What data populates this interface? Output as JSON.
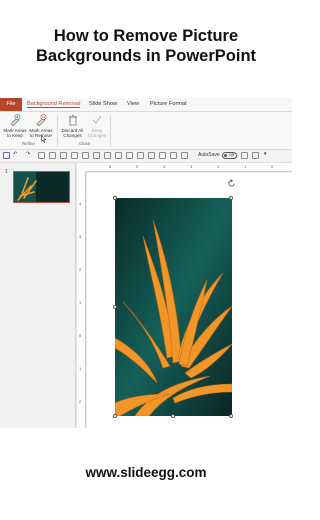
{
  "headline": {
    "line1": "How to Remove Picture",
    "line2": "Backgrounds in PowerPoint"
  },
  "ribbon_tabs": {
    "file": "File",
    "background_removal": "Background Removal",
    "slide_show": "Slide Show",
    "view": "View",
    "picture_format": "Picture Format"
  },
  "ribbon": {
    "mark_keep_line1": "Mark Areas",
    "mark_keep_line2": "to Keep",
    "mark_remove_line1": "Mark Areas",
    "mark_remove_line2": "to Remove",
    "discard_line1": "Discard All",
    "discard_line2": "Changes",
    "keep_line1": "Keep",
    "keep_line2": "Changes",
    "group_refine": "Refine",
    "group_close": "Close"
  },
  "quick_access": {
    "autosave_label": "AutoSave",
    "toggle_state": "Off"
  },
  "slides_panel": {
    "slide_number": "1"
  },
  "ruler": {
    "h_ticks": [
      "6",
      "5",
      "4",
      "3",
      "2",
      "1",
      "0"
    ],
    "v_ticks": [
      "4",
      "3",
      "2",
      "1",
      "0",
      "1",
      "2"
    ]
  },
  "footer": {
    "website": "www.slideegg.com"
  },
  "colors": {
    "accent": "#b7472a",
    "thumb_border": "#c0504d",
    "flower_orange": "#f2962a",
    "background_teal": "#0f3d3a"
  }
}
